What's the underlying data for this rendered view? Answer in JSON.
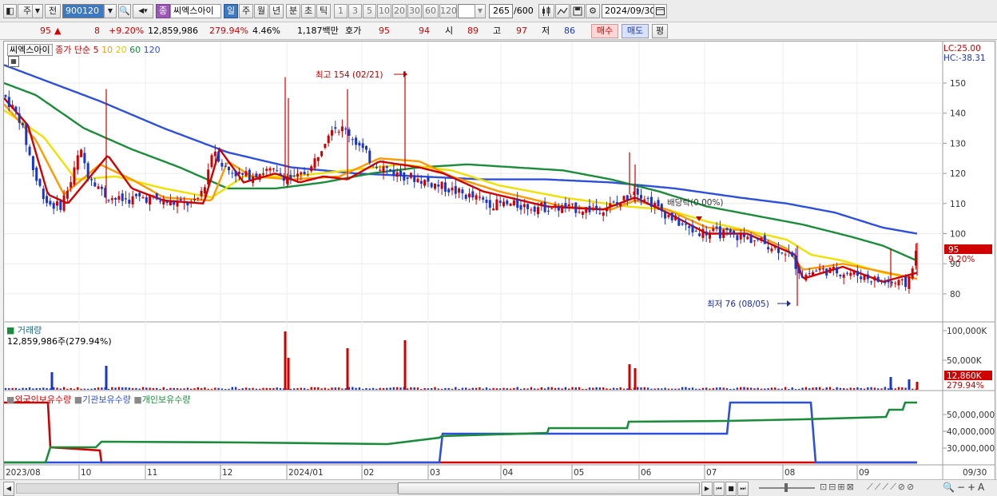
{
  "toolbar": {
    "mode": "주",
    "prev": "전",
    "code": "900120",
    "stock_name": "씨엑스아이",
    "stock_badge": "종",
    "periods": [
      "일",
      "주",
      "월",
      "년",
      "분",
      "초",
      "틱"
    ],
    "active_period": "일",
    "intervals": [
      "1",
      "3",
      "5",
      "10",
      "20",
      "30",
      "60",
      "120"
    ],
    "count": "265",
    "count_total": "/600",
    "date": "2024/09/30"
  },
  "quote": {
    "price": "95",
    "change_arrow": "▲",
    "change": "8",
    "change_pct": "+9.20%",
    "volume": "12,859,986",
    "volume_ratio": "279.94%",
    "turnover": "4.46%",
    "amount": "1,187백만",
    "ask_label": "호가",
    "ask": "95",
    "bid": "94",
    "open_label": "시",
    "open": "89",
    "high_label": "고",
    "high": "97",
    "low_label": "저",
    "low": "86",
    "buy_label": "매수",
    "sell_label": "매도",
    "eval_label": "평"
  },
  "price_panel": {
    "name_tag": "씨엑스아이",
    "ma_title": "종가 단순",
    "ma_periods": [
      "5",
      "10",
      "20",
      "60",
      "120"
    ],
    "ma_colors": [
      "#d00000",
      "#ff9900",
      "#f0e000",
      "#1a8c3a",
      "#2d50dc"
    ],
    "lc_label": "LC:25.00",
    "hc_label": "HC:-38.31",
    "y_ticks": [
      "150",
      "140",
      "130",
      "120",
      "110",
      "100",
      "90",
      "80"
    ],
    "high_annotation": "최고 154 (02/21)",
    "low_annotation": "최저 76 (08/05)",
    "dividend_annotation": "배당락(0.00%)",
    "current_price_tag": "95",
    "current_pct_tag": "9.20%"
  },
  "volume_panel": {
    "title": "거래량",
    "value_text": "12,859,986주(279.94%)",
    "y_ticks": [
      "100,000K",
      "50,000K"
    ],
    "current_tag": "12,860K",
    "current_pct": "279.94%"
  },
  "holding_panel": {
    "series": [
      "외국인보유수량",
      "기관보유수량",
      "개인보유수량"
    ],
    "series_colors": [
      "#d00000",
      "#2d50dc",
      "#1a8c3a"
    ],
    "y_ticks": [
      "50,000,000",
      "40,000,000",
      "30,000,000"
    ]
  },
  "x_axis": {
    "labels": [
      "2023/08",
      "10",
      "11",
      "12",
      "2024/01",
      "02",
      "03",
      "04",
      "05",
      "06",
      "07",
      "08",
      "09"
    ],
    "end_label": "09/30"
  },
  "chart_data": {
    "type": "candlestick",
    "period": "2023/08 - 2024/09/30",
    "price_range": [
      74,
      158
    ],
    "anchors": [
      [
        0,
        146
      ],
      [
        20,
        138
      ],
      [
        40,
        118
      ],
      [
        55,
        110
      ],
      [
        70,
        109
      ],
      [
        85,
        118
      ],
      [
        95,
        128
      ],
      [
        105,
        120
      ],
      [
        115,
        117
      ],
      [
        125,
        113
      ],
      [
        145,
        111
      ],
      [
        175,
        112
      ],
      [
        215,
        110
      ],
      [
        240,
        110
      ],
      [
        252,
        117
      ],
      [
        262,
        129
      ],
      [
        275,
        122
      ],
      [
        300,
        119
      ],
      [
        330,
        121
      ],
      [
        365,
        118
      ],
      [
        385,
        122
      ],
      [
        410,
        136
      ],
      [
        430,
        134
      ],
      [
        460,
        124
      ],
      [
        490,
        120
      ],
      [
        520,
        118
      ],
      [
        555,
        115
      ],
      [
        575,
        113
      ],
      [
        610,
        110
      ],
      [
        660,
        109
      ],
      [
        740,
        108
      ],
      [
        770,
        110
      ],
      [
        790,
        115
      ],
      [
        820,
        108
      ],
      [
        860,
        101
      ],
      [
        900,
        100
      ],
      [
        940,
        98
      ],
      [
        980,
        94
      ],
      [
        1000,
        86
      ],
      [
        1020,
        88
      ],
      [
        1060,
        87
      ],
      [
        1100,
        84
      ],
      [
        1130,
        83
      ],
      [
        1143,
        95
      ]
    ],
    "volume_spikes": [
      [
        60,
        22
      ],
      [
        128,
        30
      ],
      [
        352,
        73
      ],
      [
        356,
        40
      ],
      [
        430,
        52
      ],
      [
        502,
        62
      ],
      [
        783,
        32
      ],
      [
        790,
        27
      ],
      [
        1110,
        16
      ],
      [
        1133,
        13
      ],
      [
        1143,
        10
      ]
    ],
    "ma_anchors": {
      "ma5": [
        [
          0,
          145
        ],
        [
          30,
          136
        ],
        [
          55,
          113
        ],
        [
          80,
          110
        ],
        [
          130,
          126
        ],
        [
          160,
          115
        ],
        [
          200,
          111
        ],
        [
          250,
          110
        ],
        [
          270,
          128
        ],
        [
          300,
          117
        ],
        [
          340,
          120
        ],
        [
          370,
          117
        ],
        [
          400,
          119
        ],
        [
          430,
          118
        ],
        [
          470,
          124
        ],
        [
          520,
          122
        ],
        [
          550,
          120
        ],
        [
          600,
          114
        ],
        [
          680,
          109
        ],
        [
          750,
          108
        ],
        [
          790,
          112
        ],
        [
          830,
          107
        ],
        [
          880,
          100
        ],
        [
          930,
          100
        ],
        [
          990,
          93
        ],
        [
          1000,
          85
        ],
        [
          1050,
          89
        ],
        [
          1100,
          84
        ],
        [
          1143,
          87
        ]
      ],
      "ma10": [
        [
          0,
          143
        ],
        [
          40,
          131
        ],
        [
          75,
          113
        ],
        [
          120,
          123
        ],
        [
          160,
          118
        ],
        [
          200,
          112
        ],
        [
          260,
          111
        ],
        [
          280,
          124
        ],
        [
          310,
          119
        ],
        [
          360,
          118
        ],
        [
          420,
          119
        ],
        [
          470,
          125
        ],
        [
          520,
          124
        ],
        [
          560,
          119
        ],
        [
          620,
          114
        ],
        [
          700,
          109
        ],
        [
          760,
          108
        ],
        [
          790,
          111
        ],
        [
          830,
          108
        ],
        [
          880,
          102
        ],
        [
          930,
          101
        ],
        [
          980,
          95
        ],
        [
          1000,
          88
        ],
        [
          1050,
          90
        ],
        [
          1143,
          85
        ]
      ],
      "ma20": [
        [
          0,
          141
        ],
        [
          50,
          132
        ],
        [
          90,
          118
        ],
        [
          140,
          119
        ],
        [
          200,
          115
        ],
        [
          260,
          112
        ],
        [
          300,
          119
        ],
        [
          360,
          119
        ],
        [
          430,
          121
        ],
        [
          500,
          123
        ],
        [
          560,
          121
        ],
        [
          620,
          116
        ],
        [
          700,
          112
        ],
        [
          780,
          109
        ],
        [
          830,
          108
        ],
        [
          880,
          104
        ],
        [
          930,
          101
        ],
        [
          980,
          98
        ],
        [
          1010,
          93
        ],
        [
          1050,
          91
        ],
        [
          1100,
          87
        ],
        [
          1143,
          85
        ]
      ],
      "ma60": [
        [
          0,
          150
        ],
        [
          40,
          146
        ],
        [
          100,
          135
        ],
        [
          160,
          128
        ],
        [
          220,
          122
        ],
        [
          280,
          115
        ],
        [
          340,
          115
        ],
        [
          400,
          117
        ],
        [
          460,
          120
        ],
        [
          520,
          122
        ],
        [
          580,
          123
        ],
        [
          640,
          122
        ],
        [
          700,
          121
        ],
        [
          760,
          118
        ],
        [
          820,
          114
        ],
        [
          880,
          109
        ],
        [
          940,
          106
        ],
        [
          1000,
          103
        ],
        [
          1060,
          99
        ],
        [
          1100,
          96
        ],
        [
          1143,
          91
        ]
      ],
      "ma120": [
        [
          0,
          156
        ],
        [
          60,
          150
        ],
        [
          120,
          144
        ],
        [
          200,
          135
        ],
        [
          280,
          127
        ],
        [
          360,
          122
        ],
        [
          440,
          120
        ],
        [
          520,
          119
        ],
        [
          600,
          118
        ],
        [
          680,
          118
        ],
        [
          760,
          117
        ],
        [
          840,
          115
        ],
        [
          920,
          112
        ],
        [
          980,
          110
        ],
        [
          1040,
          107
        ],
        [
          1100,
          102
        ],
        [
          1143,
          100
        ]
      ]
    }
  }
}
